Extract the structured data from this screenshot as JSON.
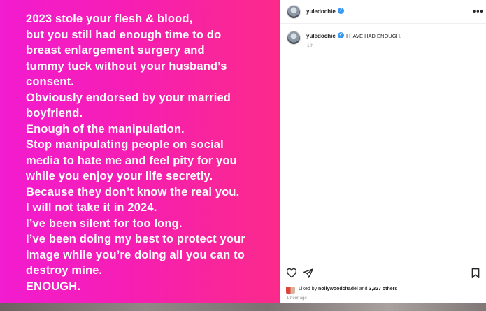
{
  "post": {
    "lines": [
      "2023 stole your flesh & blood,",
      "but you still had enough time to do",
      "breast enlargement surgery and",
      "tummy tuck without your husband’s",
      "consent.",
      "Obviously endorsed by your married",
      "boyfriend.",
      "Enough of the manipulation.",
      "Stop manipulating people on social",
      "media to hate me and feel pity for you",
      "while you enjoy your life secretly.",
      "Because they don’t know the real you.",
      "I will not take it in 2024.",
      "I’ve been silent for too long.",
      "I’ve been doing my best to protect your",
      "image while you’re doing all you can to",
      "destroy mine.",
      "ENOUGH."
    ],
    "background_colors": [
      "#f21cd0",
      "#fb2a8a"
    ]
  },
  "header": {
    "username": "yuledochie",
    "more_label": "•••"
  },
  "caption": {
    "username": "yuledochie",
    "text": "I HAVE HAD ENOUGH.",
    "time": "1 h"
  },
  "actions": {
    "icons": [
      "heart-icon",
      "share-icon",
      "bookmark-icon"
    ]
  },
  "likes": {
    "prefix": "Liked by",
    "user": "nollywoodcitadel",
    "middle": "and",
    "count": "3,327 others"
  },
  "post_time": "1 hour ago",
  "colors": {
    "verified": "#3897f0",
    "muted_text": "#8e8e8e"
  }
}
